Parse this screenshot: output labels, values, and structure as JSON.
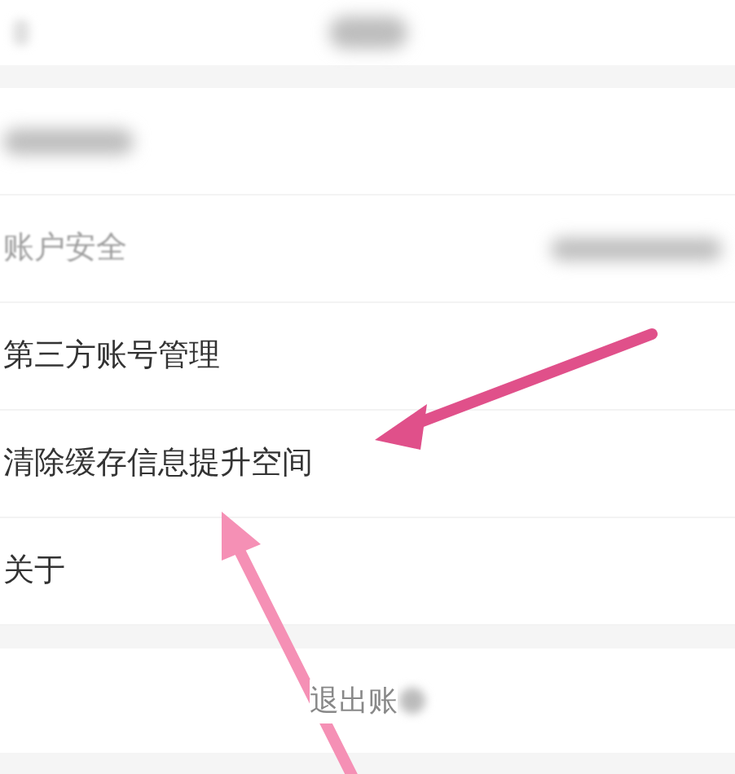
{
  "settings_rows": [
    {
      "kind": "blurred",
      "label": ""
    },
    {
      "kind": "faded",
      "label": "账户安全"
    },
    {
      "kind": "normal",
      "label": "第三方账号管理"
    },
    {
      "kind": "normal",
      "label": "清除缓存信息提升空间"
    },
    {
      "kind": "normal",
      "label": "关于"
    }
  ],
  "logout_button": {
    "label": "退出账"
  }
}
